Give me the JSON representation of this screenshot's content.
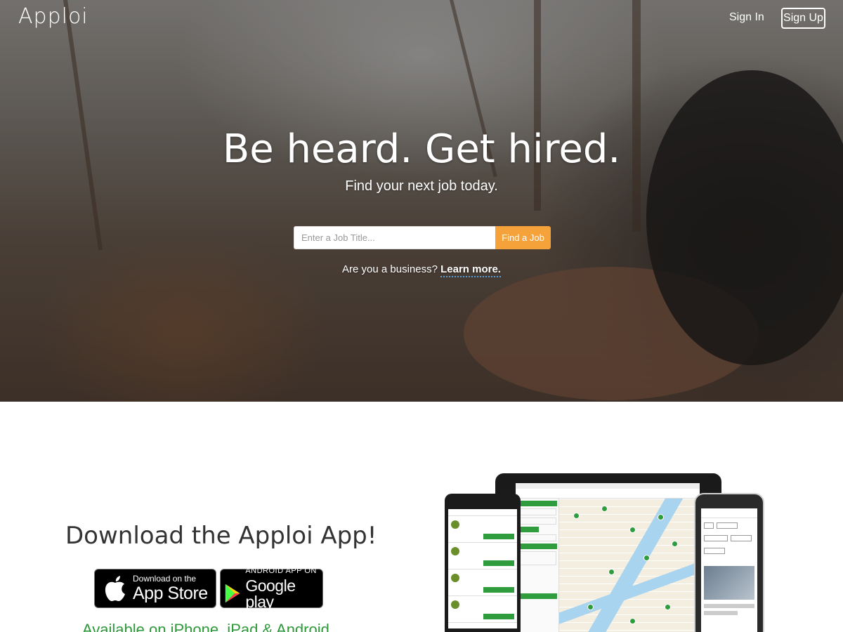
{
  "header": {
    "logo": "Apploi",
    "signin_label": "Sign In",
    "signup_label": "Sign Up"
  },
  "hero": {
    "headline": "Be heard. Get hired.",
    "subhead": "Find your next job today.",
    "search_placeholder": "Enter a Job Title...",
    "find_button": "Find a Job",
    "business_text": "Are you a business?",
    "learn_more": "Learn more."
  },
  "app_section": {
    "title": "Download the Apploi App!",
    "app_store_small": "Download on the",
    "app_store_big": "App Store",
    "google_small": "ANDROID APP ON",
    "google_big": "Google play",
    "available": "Available on iPhone, iPad & Android"
  },
  "colors": {
    "accent_orange": "#f5a23a",
    "brand_green": "#2e9a3a"
  }
}
